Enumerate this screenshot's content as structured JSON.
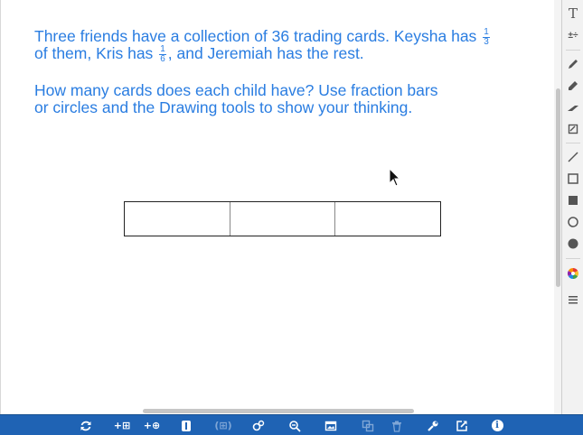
{
  "prompt": {
    "paragraph1_line1": "Three friends have a collection of 36 trading cards. Keysha has",
    "keysha_fraction": {
      "numerator": "1",
      "denominator": "3"
    },
    "paragraph1_line2_pre": "of them, Kris has",
    "kris_fraction": {
      "numerator": "1",
      "denominator": "6"
    },
    "paragraph1_line2_post": ", and Jeremiah has the rest.",
    "paragraph2_line1": "How many cards does each child have? Use fraction bars",
    "paragraph2_line2": "or circles and the Drawing tools to show your thinking."
  },
  "fraction_bar": {
    "segments": 3
  },
  "side_toolbar": {
    "items": [
      "text-tool-icon",
      "math-tool-icon",
      "pen-icon",
      "marker-icon",
      "highlighter-icon",
      "eraser-icon",
      "line-icon",
      "rectangle-outline-icon",
      "rectangle-filled-icon",
      "circle-outline-icon",
      "circle-filled-icon",
      "color-palette-icon",
      "menu-icon"
    ],
    "text_glyph": "T",
    "math_glyph": "±÷"
  },
  "bottom_toolbar": {
    "items": [
      "refresh-icon",
      "add-table-icon",
      "add-circle-icon",
      "select-icon",
      "group-icon",
      "link-icon",
      "zoom-out-icon",
      "image-icon",
      "duplicate-icon",
      "delete-icon",
      "wrench-icon",
      "share-icon",
      "info-icon"
    ],
    "add_table_glyph": "+⊞",
    "add_circle_glyph": "+⊕",
    "group_glyph": "(⊞)",
    "info_glyph": "i"
  },
  "colors": {
    "prompt_text": "#2a7de1",
    "bottom_toolbar_bg": "#1f63b4",
    "side_toolbar_bg": "#f2f2f2"
  }
}
